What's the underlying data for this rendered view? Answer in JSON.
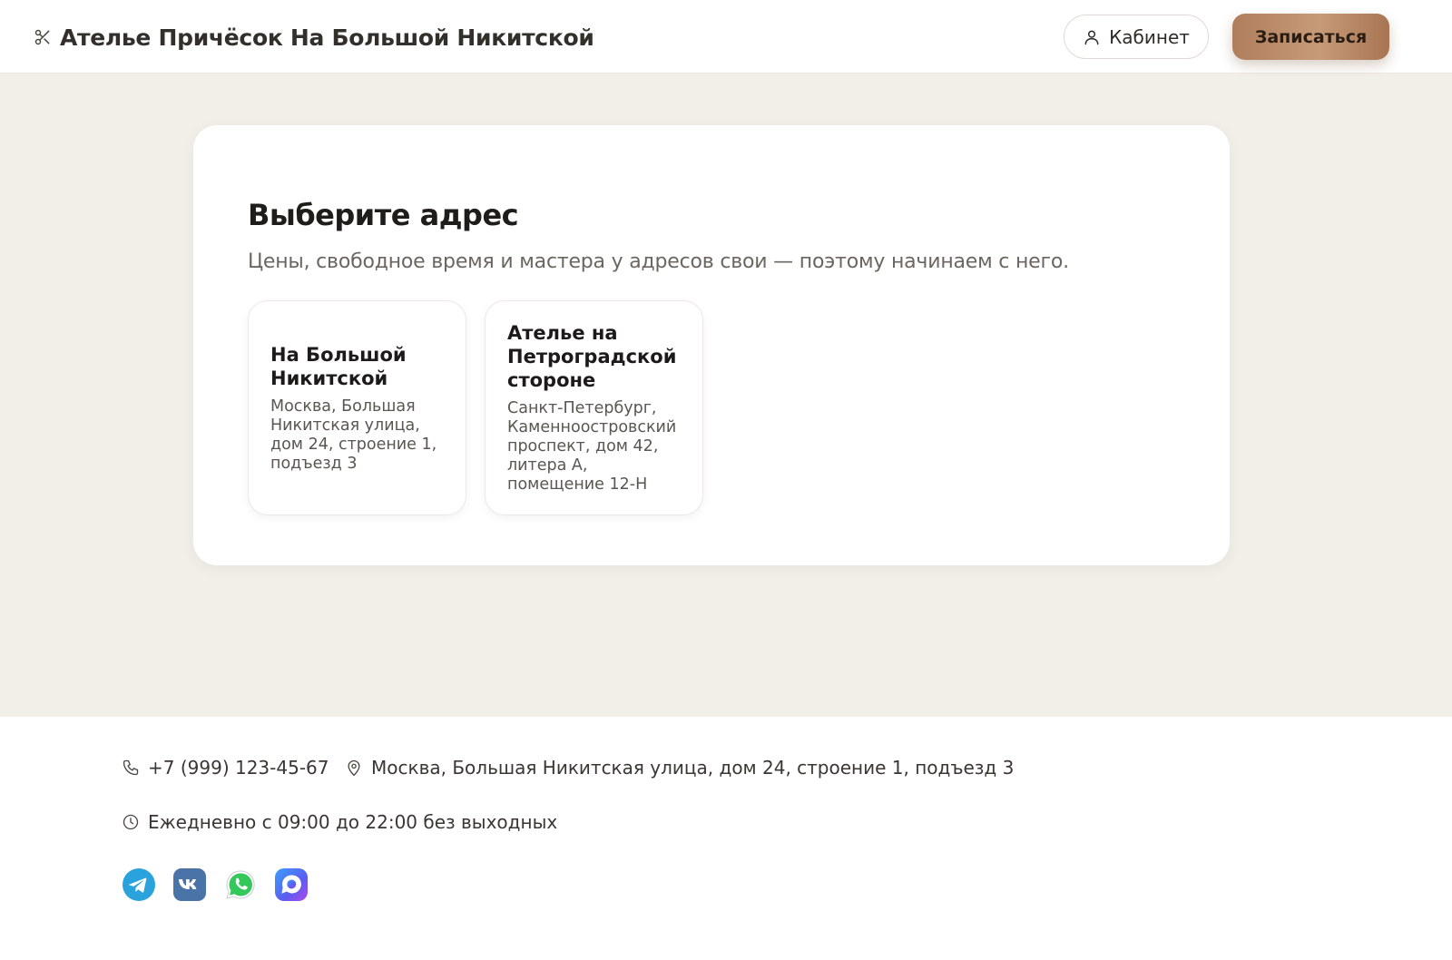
{
  "header": {
    "brand_icon": "scissors-icon",
    "title": "Ателье Причёсок На Большой Никитской",
    "cabinet_label": "Кабинет",
    "book_label": "Записаться"
  },
  "main": {
    "title": "Выберите адрес",
    "subtitle": "Цены, свободное время и мастера у адресов свои — поэтому начинаем с него.",
    "locations": [
      {
        "name": "На Большой Никитской",
        "address": "Москва, Большая Никитская улица, дом 24, строение 1, подъезд 3"
      },
      {
        "name": "Ателье на Петроградской стороне",
        "address": "Санкт-Петербург, Каменноостровский проспект, дом 42, литера А, помещение 12-Н"
      }
    ]
  },
  "footer": {
    "phone": "+7 (999) 123-45-67",
    "address": "Москва, Большая Никитская улица, дом 24, строение 1, подъезд 3",
    "hours": "Ежедневно с 09:00 до 22:00 без выходных",
    "socials": [
      "telegram-icon",
      "vk-icon",
      "whatsapp-icon",
      "max-messenger-icon"
    ]
  },
  "colors": {
    "page_bg": "#f2efe9",
    "accent": "#b8896a",
    "card_bg": "#ffffff"
  }
}
